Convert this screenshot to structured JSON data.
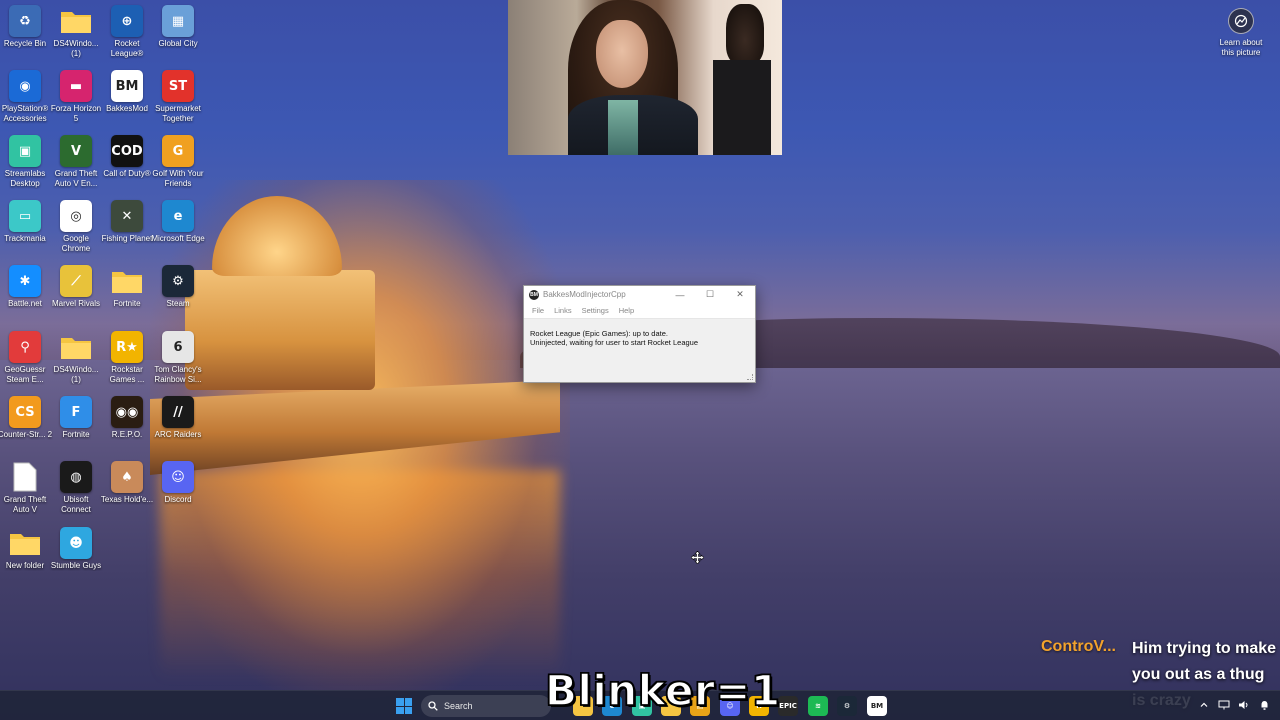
{
  "desktop": {
    "icons": [
      {
        "label": "Recycle Bin",
        "icon": "recycle-bin-icon",
        "bg": "#3b6bb5",
        "glyph": "♻"
      },
      {
        "label": "DS4Windo... (1)",
        "icon": "folder-icon",
        "bg": "#f5c542",
        "glyph": ""
      },
      {
        "label": "Rocket League®",
        "icon": "rocket-league-icon",
        "bg": "#1d5fb3",
        "glyph": "⊕"
      },
      {
        "label": "Global City",
        "icon": "global-city-icon",
        "bg": "#6aa0d8",
        "glyph": "▦"
      },
      {
        "label": "PlayStation® Accessories",
        "icon": "playstation-icon",
        "bg": "#1b6ad6",
        "glyph": "◉"
      },
      {
        "label": "Forza Horizon 5",
        "icon": "forza-icon",
        "bg": "#d6246e",
        "glyph": "▬"
      },
      {
        "label": "BakkesMod",
        "icon": "bakkesmod-icon",
        "bg": "#ffffff",
        "glyph": "BM"
      },
      {
        "label": "Supermarket Together",
        "icon": "supermarket-icon",
        "bg": "#e2322b",
        "glyph": "ST"
      },
      {
        "label": "Streamlabs Desktop",
        "icon": "streamlabs-icon",
        "bg": "#31c3a2",
        "glyph": "▣"
      },
      {
        "label": "Grand Theft Auto V En...",
        "icon": "gta-icon",
        "bg": "#2c6b2f",
        "glyph": "V"
      },
      {
        "label": "Call of Duty®",
        "icon": "call-of-duty-icon",
        "bg": "#111111",
        "glyph": "COD"
      },
      {
        "label": "Golf With Your Friends",
        "icon": "golf-icon",
        "bg": "#f0a020",
        "glyph": "G"
      },
      {
        "label": "Trackmania",
        "icon": "trackmania-icon",
        "bg": "#3cc8c8",
        "glyph": "▭"
      },
      {
        "label": "Google Chrome",
        "icon": "chrome-icon",
        "bg": "#ffffff",
        "glyph": "◎"
      },
      {
        "label": "Fishing Planet",
        "icon": "fishing-planet-icon",
        "bg": "#3d4a3c",
        "glyph": "✕"
      },
      {
        "label": "Microsoft Edge",
        "icon": "edge-icon",
        "bg": "#1e88d0",
        "glyph": "e"
      },
      {
        "label": "Battle.net",
        "icon": "battlenet-icon",
        "bg": "#148eff",
        "glyph": "✱"
      },
      {
        "label": "Marvel Rivals",
        "icon": "marvel-rivals-icon",
        "bg": "#e8c23a",
        "glyph": "⟋"
      },
      {
        "label": "Fortnite",
        "icon": "folder-icon",
        "bg": "#f5c542",
        "glyph": ""
      },
      {
        "label": "Steam",
        "icon": "steam-icon",
        "bg": "#1b2838",
        "glyph": "⚙"
      },
      {
        "label": "GeoGuessr Steam E...",
        "icon": "geoguessr-icon",
        "bg": "#e23b3b",
        "glyph": "⚲"
      },
      {
        "label": "DS4Windo... (1)",
        "icon": "folder-icon",
        "bg": "#f5c542",
        "glyph": ""
      },
      {
        "label": "Rockstar Games ...",
        "icon": "rockstar-icon",
        "bg": "#f2b400",
        "glyph": "R★"
      },
      {
        "label": "Tom Clancy's Rainbow Si...",
        "icon": "rainbow-six-icon",
        "bg": "#e6e6e6",
        "glyph": "6"
      },
      {
        "label": "Counter-Str... 2",
        "icon": "counter-strike-icon",
        "bg": "#f29a1d",
        "glyph": "CS"
      },
      {
        "label": "Fortnite",
        "icon": "fortnite-icon",
        "bg": "#2f8ee8",
        "glyph": "F"
      },
      {
        "label": "R.E.P.O.",
        "icon": "repo-icon",
        "bg": "#2a1d12",
        "glyph": "◉◉"
      },
      {
        "label": "ARC Raiders",
        "icon": "arc-raiders-icon",
        "bg": "#1a1a1a",
        "glyph": "//"
      },
      {
        "label": "Grand Theft Auto V",
        "icon": "file-icon",
        "bg": "#ffffff",
        "glyph": ""
      },
      {
        "label": "Ubisoft Connect",
        "icon": "ubisoft-icon",
        "bg": "#1a1a1a",
        "glyph": "◍"
      },
      {
        "label": "Texas Hold'e...",
        "icon": "texas-holdem-icon",
        "bg": "#c98a5a",
        "glyph": "♠"
      },
      {
        "label": "Discord",
        "icon": "discord-icon",
        "bg": "#5865f2",
        "glyph": "☺"
      },
      {
        "label": "New folder",
        "icon": "folder-icon",
        "bg": "#f5c542",
        "glyph": ""
      },
      {
        "label": "Stumble Guys",
        "icon": "stumble-guys-icon",
        "bg": "#2ea7e0",
        "glyph": "☻"
      }
    ]
  },
  "learn_widget": {
    "label": "Learn about this picture"
  },
  "window": {
    "title": "BakkesModInjectorCpp",
    "minimize": "—",
    "maximize": "☐",
    "close": "✕",
    "menu": [
      "File",
      "Links",
      "Settings",
      "Help"
    ],
    "status_lines": [
      "Rocket League (Epic Games): up to date.",
      "Uninjected, waiting for user to start Rocket League"
    ]
  },
  "overlay": {
    "caption": "Blinker=1",
    "chat_user": "ControV...",
    "chat_message": "Him trying to make you out as a thug is crazy"
  },
  "taskbar": {
    "search_label": "Search",
    "apps": [
      {
        "name": "file-explorer-icon",
        "bg": "#f5c542",
        "glyph": ""
      },
      {
        "name": "edge-icon",
        "bg": "#1e88d0",
        "glyph": "e"
      },
      {
        "name": "streamlabs-icon",
        "bg": "#31c3a2",
        "glyph": "▣"
      },
      {
        "name": "folder-icon",
        "bg": "#f5c542",
        "glyph": ""
      },
      {
        "name": "notes-icon",
        "bg": "#e8a317",
        "glyph": "▤"
      },
      {
        "name": "discord-icon",
        "bg": "#5865f2",
        "glyph": "☺"
      },
      {
        "name": "rockstar-icon",
        "bg": "#f2b400",
        "glyph": "R"
      },
      {
        "name": "epic-games-icon",
        "bg": "#2a2a2a",
        "glyph": "EPIC"
      },
      {
        "name": "spotify-icon",
        "bg": "#1db954",
        "glyph": "≋"
      },
      {
        "name": "steam-icon",
        "bg": "#1b2838",
        "glyph": "⚙"
      },
      {
        "name": "bakkesmod-icon",
        "bg": "#ffffff",
        "glyph": "BM"
      }
    ],
    "tray": [
      "chevron-up-icon",
      "network-icon",
      "volume-icon",
      "notification-icon"
    ]
  },
  "colors": {
    "chat_user": "#f2a22c",
    "taskbar": "#20243a",
    "start_blue": "#3aa0f0"
  }
}
